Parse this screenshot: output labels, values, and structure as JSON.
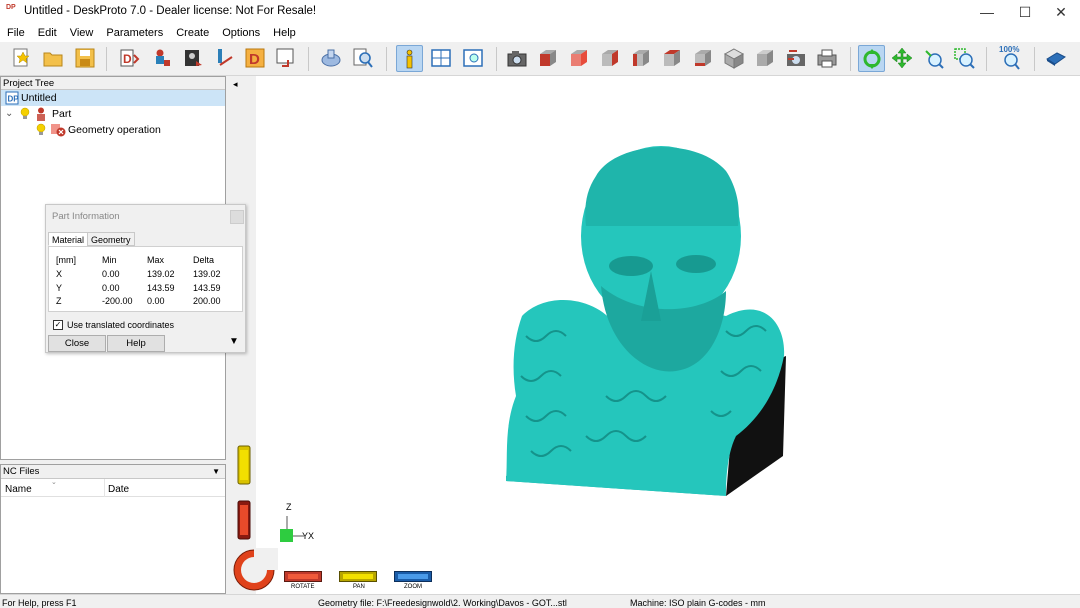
{
  "window": {
    "logo_text": "DP",
    "title": "Untitled - DeskProto 7.0 - Dealer license: Not For Resale!",
    "minimize_glyph": "—",
    "maximize_glyph": "☐",
    "close_glyph": "✕"
  },
  "menu": [
    "File",
    "Edit",
    "View",
    "Parameters",
    "Create",
    "Options",
    "Help"
  ],
  "toolbar": {
    "icons": [
      "new-project-icon",
      "open-project-icon",
      "save-project-icon",
      "load-geometry-icon",
      "part-wizard-icon",
      "image-wizard-icon",
      "toolpath-icon",
      "draw-icon",
      "nc-export-icon",
      "simulation-icon",
      "search-icon",
      "info-icon",
      "layout-icon",
      "view-icon",
      "camera-icon",
      "front-view-icon",
      "back-view-icon",
      "left-view-icon",
      "right-view-icon",
      "top-view-icon",
      "bottom-view-icon",
      "iso-view-icon",
      "iso-view-2-icon",
      "refresh-icon",
      "print-icon",
      "rotate-icon",
      "pan-icon",
      "zoom-in-icon",
      "zoom-window-icon",
      "zoom-100-icon",
      "book-icon"
    ],
    "zoom_label": "100%"
  },
  "project_tree": {
    "header": "Project Tree",
    "items": [
      {
        "label": "Untitled",
        "level": 0,
        "selected": true
      },
      {
        "label": "Part",
        "level": 1,
        "selected": false
      },
      {
        "label": "Geometry operation",
        "level": 2,
        "selected": false
      }
    ]
  },
  "nc_files": {
    "header": "NC Files",
    "columns": [
      "Name",
      "Date"
    ]
  },
  "part_info": {
    "title": "Part Information",
    "tabs": [
      "Material",
      "Geometry"
    ],
    "active_tab": "Material",
    "headers": [
      "[mm]",
      "Min",
      "Max",
      "Delta"
    ],
    "rows": [
      {
        "axis": "X",
        "min": "0.00",
        "max": "139.02",
        "delta": "139.02"
      },
      {
        "axis": "Y",
        "min": "0.00",
        "max": "143.59",
        "delta": "143.59"
      },
      {
        "axis": "Z",
        "min": "-200.00",
        "max": "0.00",
        "delta": "200.00"
      }
    ],
    "checkbox_label": "Use translated coordinates",
    "checkbox_checked": true,
    "close_label": "Close",
    "help_label": "Help"
  },
  "viewport": {
    "model_color": "#25c6bc",
    "axis_labels": {
      "z": "Z",
      "yx": "YX"
    },
    "nav_labels": {
      "rotate": "ROTATE",
      "pan": "PAN",
      "zoom": "ZOOM"
    },
    "collapse_glyph": "◂"
  },
  "status": {
    "help": "For Help, press F1",
    "geometry": "Geometry file: F:\\Freedesignwold\\2. Working\\Davos - GOT...stl",
    "machine": "Machine: ISO plain G-codes - mm"
  }
}
